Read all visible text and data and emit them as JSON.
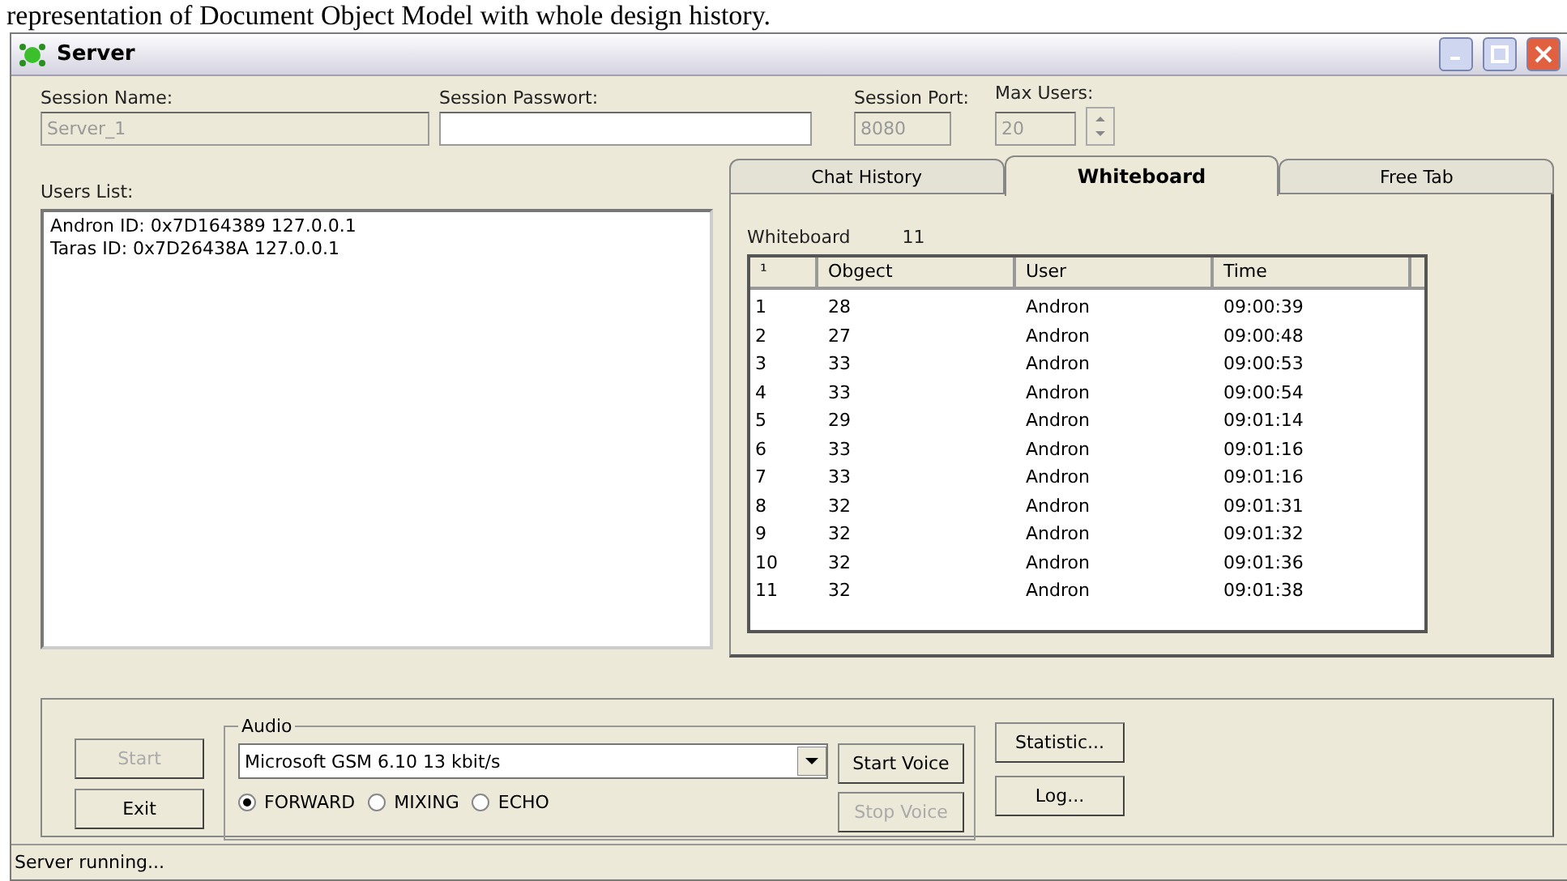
{
  "caption": "representation of Document Object Model with whole design history.",
  "window": {
    "title": "Server"
  },
  "fields": [
    {
      "label": "Session Name:",
      "value": "Server_1",
      "disabled": true,
      "kind": "text"
    },
    {
      "label": "Session Passwort:",
      "disabled": false,
      "kind": "text"
    },
    {
      "label": "Session Port:",
      "value": "8080",
      "disabled": true,
      "kind": "text"
    },
    {
      "label": "Max Users:",
      "value": "20",
      "disabled": true,
      "kind": "spin"
    }
  ],
  "users": {
    "label": "Users List:",
    "items": [
      "Andron ID: 0x7D164389 127.0.0.1",
      "Taras ID: 0x7D26438A 127.0.0.1"
    ]
  },
  "tabs": [
    {
      "label": "Chat History",
      "selected": false
    },
    {
      "label": "Whiteboard",
      "selected": true
    },
    {
      "label": "Free Tab",
      "selected": false
    }
  ],
  "whiteboard": {
    "label": "Whiteboard",
    "count": "11",
    "table": {
      "columns": [
        "¹",
        "Obgect",
        "User",
        "Time"
      ],
      "rows": [
        [
          "1",
          "28",
          "Andron",
          "09:00:39"
        ],
        [
          "2",
          "27",
          "Andron",
          "09:00:48"
        ],
        [
          "3",
          "33",
          "Andron",
          "09:00:53"
        ],
        [
          "4",
          "33",
          "Andron",
          "09:00:54"
        ],
        [
          "5",
          "29",
          "Andron",
          "09:01:14"
        ],
        [
          "6",
          "33",
          "Andron",
          "09:01:16"
        ],
        [
          "7",
          "33",
          "Andron",
          "09:01:16"
        ],
        [
          "8",
          "32",
          "Andron",
          "09:01:31"
        ],
        [
          "9",
          "32",
          "Andron",
          "09:01:32"
        ],
        [
          "10",
          "32",
          "Andron",
          "09:01:36"
        ],
        [
          "11",
          "32",
          "Andron",
          "09:01:38"
        ]
      ]
    }
  },
  "controls": {
    "start": {
      "label": "Start",
      "disabled": true
    },
    "exit": {
      "label": "Exit",
      "disabled": false
    }
  },
  "audio": {
    "label": "Audio",
    "codec": "Microsoft GSM 6.10 13 kbit/s",
    "modes": [
      {
        "label": "FORWARD",
        "selected": true
      },
      {
        "label": "MIXING",
        "selected": false
      },
      {
        "label": "ECHO",
        "selected": false
      }
    ],
    "start_voice": {
      "label": "Start Voice",
      "disabled": false
    },
    "stop_voice": {
      "label": "Stop Voice",
      "disabled": true
    }
  },
  "side_buttons": [
    "Statistic...",
    "Log..."
  ],
  "status_bar": "Server running..."
}
